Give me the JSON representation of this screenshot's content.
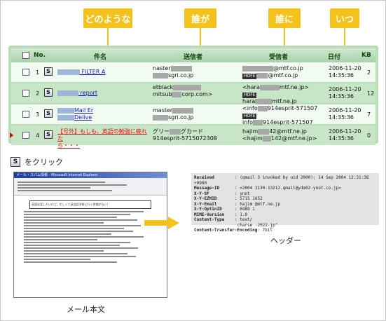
{
  "tags": {
    "what": "どのような",
    "who": "誰が",
    "to_whom": "誰に",
    "when": "いつ"
  },
  "table": {
    "headers": {
      "no": "No.",
      "subject": "件名",
      "sender": "送信者",
      "recipient": "受信者",
      "date": "日付",
      "kb": "KB"
    },
    "rows": [
      {
        "no": "1",
        "subject_line1": "FILTER A",
        "sender_line1": "naster",
        "sender_line2": "sgri.co.jp",
        "recipient_line1": "@mtf.co.jp",
        "recipient_line2": "@mtf.co.jp",
        "date_line1": "2006-11-20",
        "date_line2": "14:35:36",
        "kb": "2"
      },
      {
        "no": "2",
        "subject_line1": "report",
        "sender_line1": "etblack",
        "sender_line2": "mitsub",
        "sender_line3": "corp.com>",
        "recipient_line1": "<hara",
        "recipient_line2": "mtf.ne.jp>",
        "recipient_line3": "hara",
        "recipient_line4": "mtf.ne.jp",
        "date_line1": "2006-11-20",
        "date_line2": "14:35:36",
        "kb": "12"
      },
      {
        "no": "3",
        "subject_line1": "Mail Er",
        "subject_line2": "Delive",
        "sender_line1": "master",
        "sender_line2": "sgri.co.jp",
        "recipient_line1": "<info",
        "recipient_line2": "914esprit-571507",
        "recipient_line3": "info",
        "recipient_line4": "914esprit-571507",
        "date_line1": "2006-11-20",
        "date_line2": "14:35:36",
        "kb": "7"
      },
      {
        "no": "4",
        "subject_line1": "【号外】もしも、英語の勉強に疲れた",
        "subject_line2": "ら・・・",
        "sender_line1": "グリー",
        "sender_line2": "グカード",
        "sender_line3": "914esprit-5715072308",
        "recipient_line1": "hajim",
        "recipient_line2": "42@mtf.ne.jp",
        "recipient_line3": "<hajim",
        "recipient_line4": "142@mtf.ne.jp>",
        "date_line1": "2006-11-20",
        "date_line2": "14:35:36",
        "kb": "0"
      }
    ]
  },
  "click_text": "をクリック",
  "icon_letter": "S",
  "mail": {
    "window_title": "メール・スパム情報 - Microsoft Internet Explorer",
    "highlight_text": "英語は話したいけど、忙しくて英会話学校に行く時間がない！",
    "caption": "メール本文"
  },
  "header_view": {
    "rows": [
      {
        "key": "Received",
        "value": ": (qmail 3 invoked by uid 2000); 14 Sep 2004 12:31:38 +0900"
      },
      {
        "key": "Message-ID",
        "value": ": <2004 3130.13212.qmail@ydm02.ynot.co.jp>"
      },
      {
        "key": "X-Y-SF",
        "value": ": ynot"
      },
      {
        "key": "X-Y-EZMID",
        "value": ": 5715 1652"
      },
      {
        "key": "X-Y-Email",
        "value": ": hajim @mtf.ne.jp"
      },
      {
        "key": "X-Y-OptinID",
        "value": ": 0489 1"
      },
      {
        "key": "MIME-Version",
        "value": ": 1.0"
      },
      {
        "key": "Content-Type",
        "value": ": text/"
      },
      {
        "key": "",
        "value": "  charse -2022-jp\""
      },
      {
        "key": "Content-Transfer-Encoding",
        "value": ": 7bit"
      }
    ],
    "caption": "ヘッダー"
  }
}
